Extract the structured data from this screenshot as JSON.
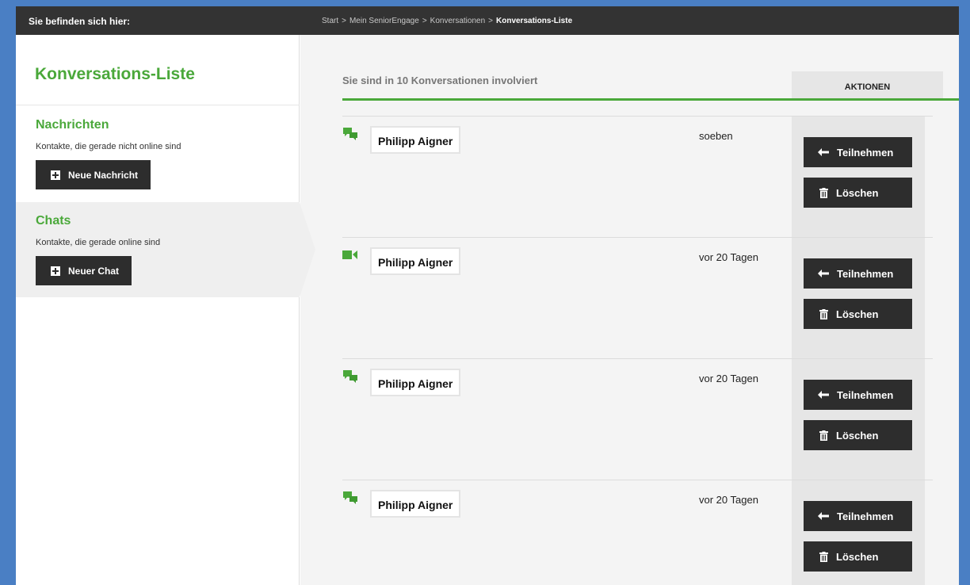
{
  "topbar": {
    "label": "Sie befinden sich hier:",
    "breadcrumbs": [
      "Start",
      "Mein SeniorEngage",
      "Konversationen",
      "Konversations-Liste"
    ],
    "separator": ">"
  },
  "sidebar": {
    "title": "Konversations-Liste",
    "nachrichten": {
      "heading": "Nachrichten",
      "description": "Kontakte, die gerade nicht online sind",
      "button_label": "Neue Nachricht"
    },
    "chats": {
      "heading": "Chats",
      "description": "Kontakte, die gerade online sind",
      "button_label": "Neuer Chat"
    }
  },
  "main": {
    "summary": "Sie sind in 10 Konversationen involviert",
    "actions_header": "AKTIONEN",
    "join_label": "Teilnehmen",
    "delete_label": "Löschen",
    "conversations": [
      {
        "type": "chat-icon",
        "name": "Philipp Aigner",
        "time": "soeben"
      },
      {
        "type": "video-icon",
        "name": "Philipp Aigner",
        "time": "vor 20 Tagen"
      },
      {
        "type": "chat-icon",
        "name": "Philipp Aigner",
        "time": "vor 20 Tagen"
      },
      {
        "type": "chat-icon",
        "name": "Philipp Aigner",
        "time": "vor 20 Tagen"
      }
    ]
  },
  "colors": {
    "accent": "#4aa83a",
    "dark": "#2d2d2d",
    "frame": "#4a7fc4"
  }
}
